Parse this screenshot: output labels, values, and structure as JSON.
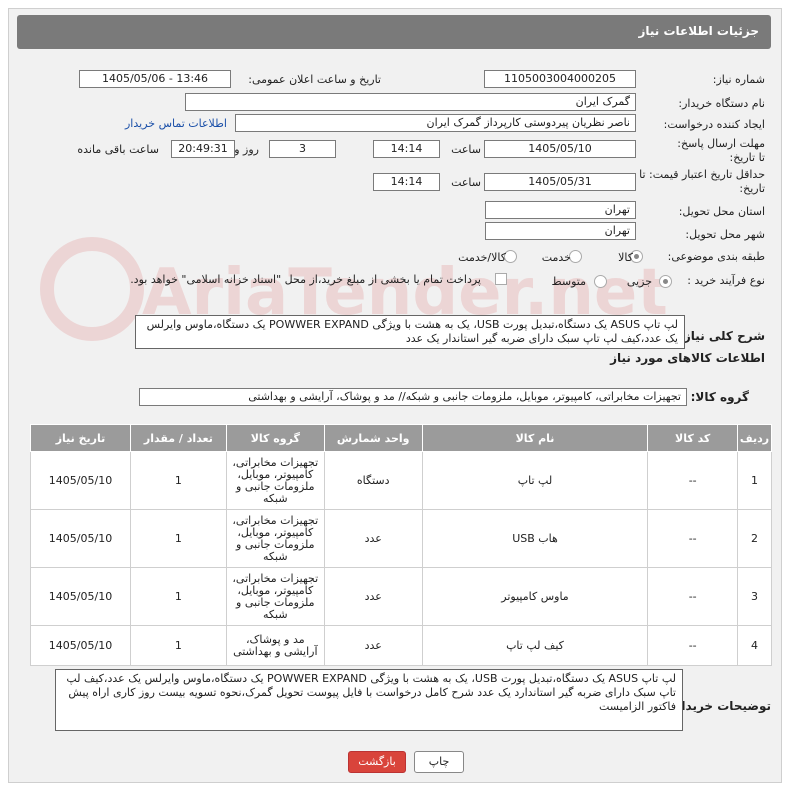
{
  "title": "جزئیات اطلاعات نیاز",
  "need_number": {
    "label": "شماره نیاز:",
    "value": "1105003004000205"
  },
  "announce_datetime": {
    "label": "تاریخ و ساعت اعلان عمومی:",
    "value": "1405/05/06 - 13:46"
  },
  "buyer_org": {
    "label": "نام دستگاه خریدار:",
    "value": "گمرک ایران"
  },
  "requester": {
    "label": "ایجاد کننده درخواست:",
    "value": "ناصر نظریان پیردوستی کارپرداز گمرک ایران",
    "contact_link": "اطلاعات تماس خریدار"
  },
  "deadline": {
    "label": "مهلت ارسال پاسخ: تا تاریخ:",
    "date": "1405/05/10",
    "time_label": "ساعت",
    "time": "14:14",
    "days": "3",
    "days_label": "روز و",
    "remaining": "20:49:31",
    "remaining_label": "ساعت باقی مانده"
  },
  "price_validity": {
    "label": "حداقل تاریخ اعتبار قیمت: تا تاریخ:",
    "date": "1405/05/31",
    "time_label": "ساعت",
    "time": "14:14"
  },
  "delivery_province": {
    "label": "استان محل تحویل:",
    "value": "تهران"
  },
  "delivery_city": {
    "label": "شهر محل تحویل:",
    "value": "تهران"
  },
  "category": {
    "label": "طبقه بندی موضوعی:",
    "options": [
      "کالا",
      "خدمت",
      "کالا/خدمت"
    ],
    "selected": 0
  },
  "process": {
    "label": "نوع فرآیند خرید :",
    "options": [
      "جزیی",
      "متوسط"
    ],
    "selected": 0,
    "payment_note": "پرداخت تمام یا بخشی از مبلغ خرید،از محل \"اسناد خزانه اسلامی\" خواهد بود."
  },
  "overall_desc": {
    "label": "شرح کلی نیاز:",
    "value": "لپ تاپ ASUS یک دستگاه،تبدیل پورت USB، یک به هشت با ویژگی POWWER EXPAND یک دستگاه،ماوس وایرلس یک عدد،کیف لپ تاپ سبک دارای ضربه گیر استاندار یک عدد"
  },
  "items_section_title": "اطلاعات کالاهای مورد نیاز",
  "goods_group": {
    "label": "گروه کالا:",
    "value": "تجهیزات مخابراتی، کامپیوتر، موبایل، ملزومات جانبی و شبکه// مد و پوشاک، آرایشی و بهداشتی"
  },
  "table": {
    "headers": [
      "ردیف",
      "کد کالا",
      "نام کالا",
      "واحد شمارش",
      "گروه کالا",
      "تعداد / مقدار",
      "تاریخ نیاز"
    ],
    "rows": [
      {
        "row": "1",
        "code": "--",
        "name": "لپ تاپ",
        "unit": "دستگاه",
        "group": "تجهیزات مخابراتی، کامپیوتر، موبایل، ملزومات جانبی و شبکه",
        "qty": "1",
        "date": "1405/05/10"
      },
      {
        "row": "2",
        "code": "--",
        "name": "هاب USB",
        "unit": "عدد",
        "group": "تجهیزات مخابراتی، کامپیوتر، موبایل، ملزومات جانبی و شبکه",
        "qty": "1",
        "date": "1405/05/10"
      },
      {
        "row": "3",
        "code": "--",
        "name": "ماوس کامپیوتر",
        "unit": "عدد",
        "group": "تجهیزات مخابراتی، کامپیوتر، موبایل، ملزومات جانبی و شبکه",
        "qty": "1",
        "date": "1405/05/10"
      },
      {
        "row": "4",
        "code": "--",
        "name": "کیف لپ تاپ",
        "unit": "عدد",
        "group": "مد و پوشاک، آرایشی و بهداشتی",
        "qty": "1",
        "date": "1405/05/10"
      }
    ]
  },
  "buyer_notes": {
    "label": "توضیحات خریدار:",
    "value": "لپ تاپ ASUS یک دستگاه،تبدیل پورت USB، یک به هشت با ویژگی POWWER EXPAND یک دستگاه،ماوس وایرلس یک عدد،کیف لپ تاپ سبک دارای ضربه گیر استاندارد یک عدد شرح کامل درخواست با فایل پیوست تحویل گمرک،نحوه تسویه بیست روز کاری اراه پیش فاکتور الزامیست"
  },
  "buttons": {
    "print": "چاپ",
    "back": "بازگشت"
  },
  "watermark": "AriaTender.net",
  "colors": {
    "back_button": "#d9443b",
    "print_button": "#ffffff",
    "title_bar": "#7a7a7a"
  }
}
